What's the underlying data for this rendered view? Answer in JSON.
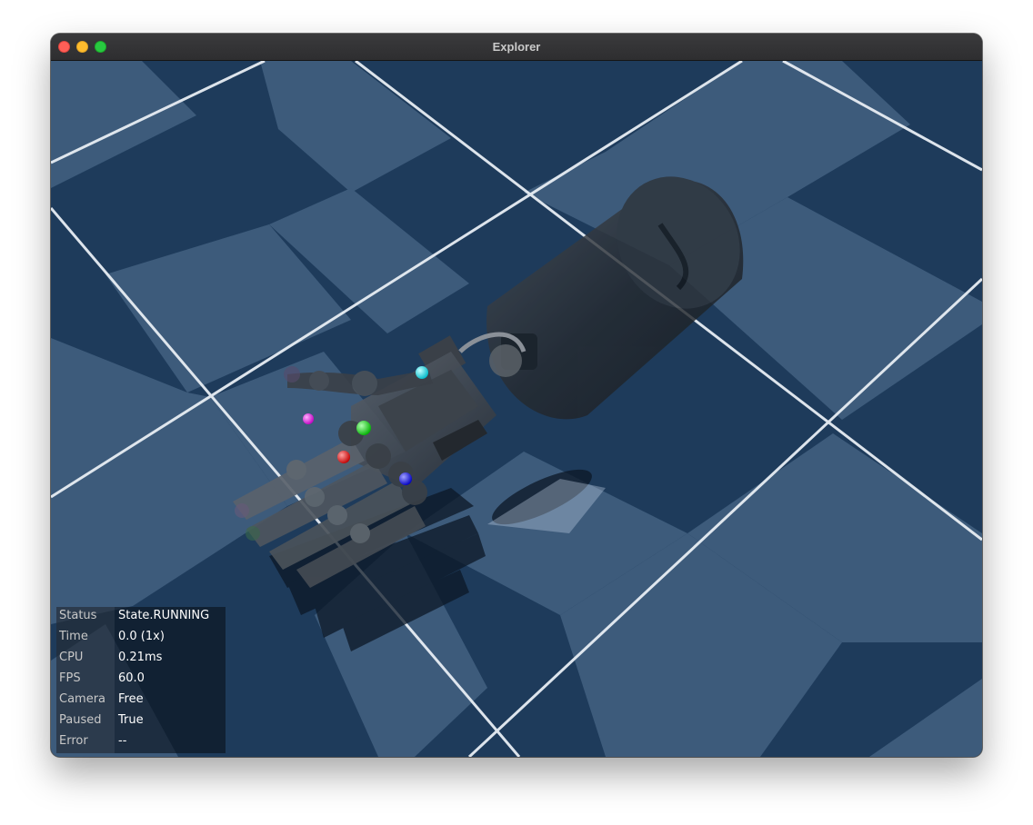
{
  "window": {
    "title": "Explorer"
  },
  "overlay": {
    "rows": [
      {
        "key": "Status",
        "value": "State.RUNNING"
      },
      {
        "key": "Time",
        "value": "0.0 (1x)"
      },
      {
        "key": "CPU",
        "value": "0.21ms"
      },
      {
        "key": "FPS",
        "value": "60.0"
      },
      {
        "key": "Camera",
        "value": "Free"
      },
      {
        "key": "Paused",
        "value": "True"
      },
      {
        "key": "Error",
        "value": "--"
      }
    ]
  },
  "colors": {
    "floor_dark": "#1d3a5a",
    "floor_light": "#3c5a7a",
    "grid_line": "#e8eef4",
    "marker_cyan": "#00d8e8",
    "marker_magenta": "#e000e0",
    "marker_green": "#10d010",
    "marker_red": "#e00000",
    "marker_blue": "#1010e0"
  }
}
